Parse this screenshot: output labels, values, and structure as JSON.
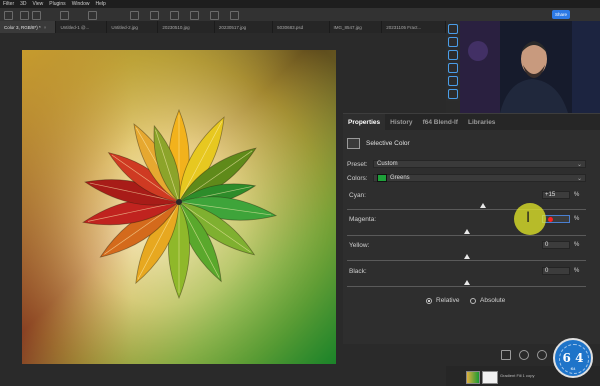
{
  "menubar": {
    "items": [
      "Filter",
      "3D",
      "View",
      "Plugins",
      "Window",
      "Help"
    ]
  },
  "optionsbar": {
    "share_label": "Share"
  },
  "tabs": [
    {
      "label": "Color 3, RGB/8*) *",
      "active": true
    },
    {
      "label": "Untitled-1 @...",
      "active": false
    },
    {
      "label": "Untitled-2.jpg",
      "active": false
    },
    {
      "label": "20230510.jpg",
      "active": false
    },
    {
      "label": "20230517.jpg",
      "active": false
    },
    {
      "label": "5030683.psd",
      "active": false
    },
    {
      "label": "IMG_8547.jpg",
      "active": false
    },
    {
      "label": "20231105 Fract...",
      "active": false
    }
  ],
  "panel": {
    "tabs": [
      {
        "label": "Properties",
        "active": true
      },
      {
        "label": "History",
        "active": false
      },
      {
        "label": "f64 Blend-If",
        "active": false
      },
      {
        "label": "Libraries",
        "active": false
      }
    ],
    "adjustment_title": "Selective Color",
    "preset_label": "Preset:",
    "preset_value": "Custom",
    "colors_label": "Colors:",
    "colors_value": "Greens",
    "swatch_color": "#1ea13a",
    "sliders": [
      {
        "label": "Cyan:",
        "value": "+15",
        "unit": "%",
        "level": 0.57
      },
      {
        "label": "Magenta:",
        "value": "",
        "unit": "%",
        "level": 0.5
      },
      {
        "label": "Yellow:",
        "value": "0",
        "unit": "%",
        "level": 0.5
      },
      {
        "label": "Black:",
        "value": "0",
        "unit": "%",
        "level": 0.5
      }
    ],
    "method": {
      "relative_label": "Relative",
      "absolute_label": "Absolute",
      "selected": "Relative"
    }
  },
  "layers": {
    "visible_label": "Gradient Fill 1 copy"
  },
  "logo": {
    "text": "6 4",
    "subtext": "f64"
  },
  "colors": {
    "accent": "#2d7ae6",
    "highlight": "#e6eb28",
    "marker": "#ff2020"
  }
}
